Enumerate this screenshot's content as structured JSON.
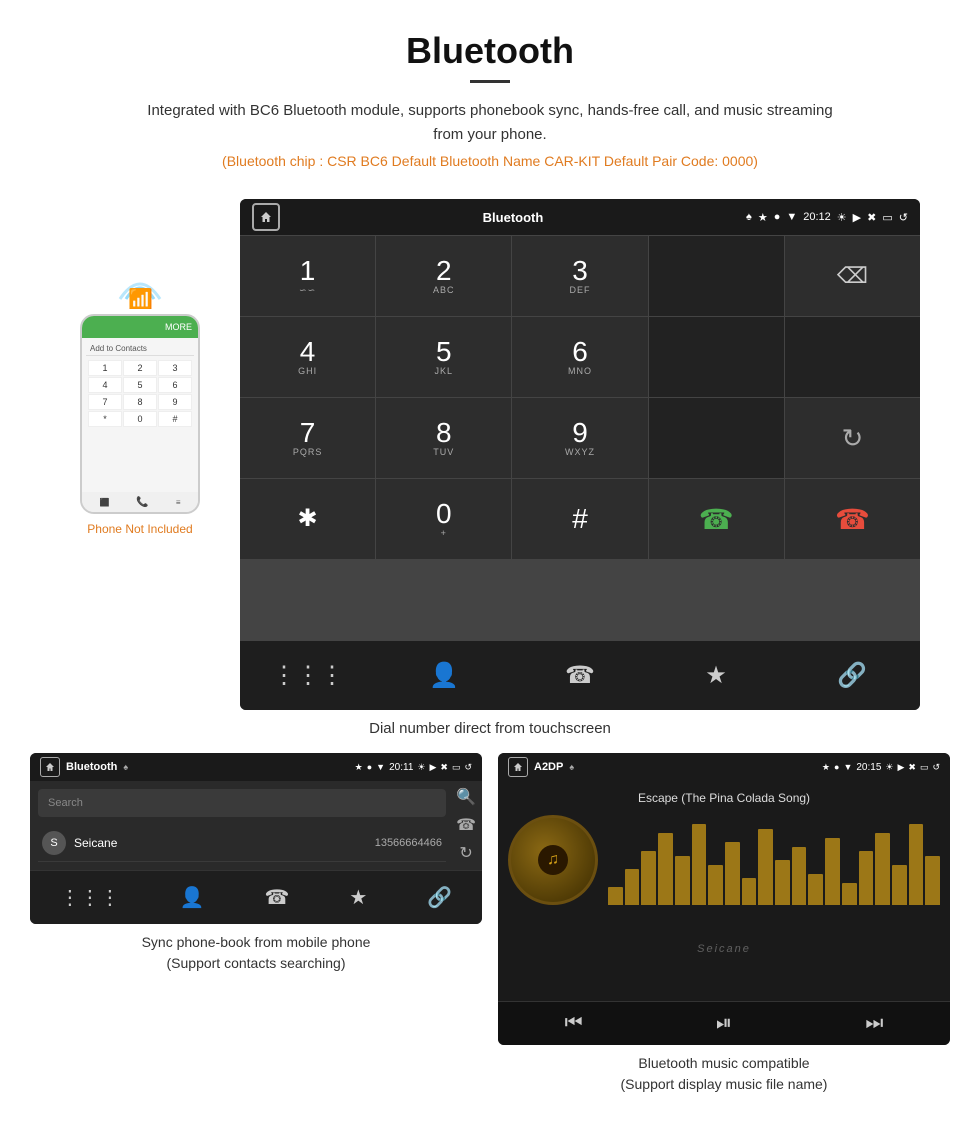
{
  "header": {
    "title": "Bluetooth",
    "description": "Integrated with BC6 Bluetooth module, supports phonebook sync, hands-free call, and music streaming from your phone.",
    "specs": "(Bluetooth chip : CSR BC6   Default Bluetooth Name CAR-KIT    Default Pair Code: 0000)"
  },
  "phone_preview": {
    "not_included_label": "Phone Not Included",
    "top_bar_text": "MORE",
    "add_contacts": "Add to Contacts",
    "keys": [
      "1",
      "2",
      "3",
      "4",
      "5",
      "6",
      "7",
      "8",
      "9",
      "*",
      "0",
      "#"
    ]
  },
  "dial_screen": {
    "status_bar": {
      "title": "Bluetooth",
      "time": "20:12"
    },
    "keys": [
      {
        "main": "1",
        "sub": "∽∽"
      },
      {
        "main": "2",
        "sub": "ABC"
      },
      {
        "main": "3",
        "sub": "DEF"
      },
      {
        "main": "",
        "sub": ""
      },
      {
        "main": "⌫",
        "sub": ""
      },
      {
        "main": "4",
        "sub": "GHI"
      },
      {
        "main": "5",
        "sub": "JKL"
      },
      {
        "main": "6",
        "sub": "MNO"
      },
      {
        "main": "",
        "sub": ""
      },
      {
        "main": "",
        "sub": ""
      },
      {
        "main": "7",
        "sub": "PQRS"
      },
      {
        "main": "8",
        "sub": "TUV"
      },
      {
        "main": "9",
        "sub": "WXYZ"
      },
      {
        "main": "",
        "sub": ""
      },
      {
        "main": "↻",
        "sub": ""
      },
      {
        "main": "✱",
        "sub": ""
      },
      {
        "main": "0",
        "sub": "+"
      },
      {
        "main": "#",
        "sub": ""
      },
      {
        "main": "📞",
        "sub": "call"
      },
      {
        "main": "📵",
        "sub": "end"
      }
    ],
    "nav_items": [
      "⊞",
      "👤",
      "📞",
      "✱",
      "🔗"
    ]
  },
  "main_caption": "Dial number direct from touchscreen",
  "phonebook_screen": {
    "status_bar": {
      "title": "Bluetooth",
      "time": "20:11"
    },
    "search_placeholder": "Search",
    "contacts": [
      {
        "letter": "S",
        "name": "Seicane",
        "number": "13566664466"
      }
    ],
    "nav_items": [
      "⊞",
      "👤",
      "📞",
      "✱",
      "🔗"
    ],
    "caption_line1": "Sync phone-book from mobile phone",
    "caption_line2": "(Support contacts searching)"
  },
  "music_screen": {
    "status_bar": {
      "title": "A2DP",
      "time": "20:15"
    },
    "song_title": "Escape (The Pina Colada Song)",
    "eq_bars": [
      20,
      40,
      60,
      80,
      55,
      90,
      45,
      70,
      30,
      85,
      50,
      65,
      35,
      75,
      25,
      60,
      80,
      45,
      90,
      55
    ],
    "controls": [
      "⏮",
      "⏯",
      "⏭"
    ],
    "caption_line1": "Bluetooth music compatible",
    "caption_line2": "(Support display music file name)"
  }
}
